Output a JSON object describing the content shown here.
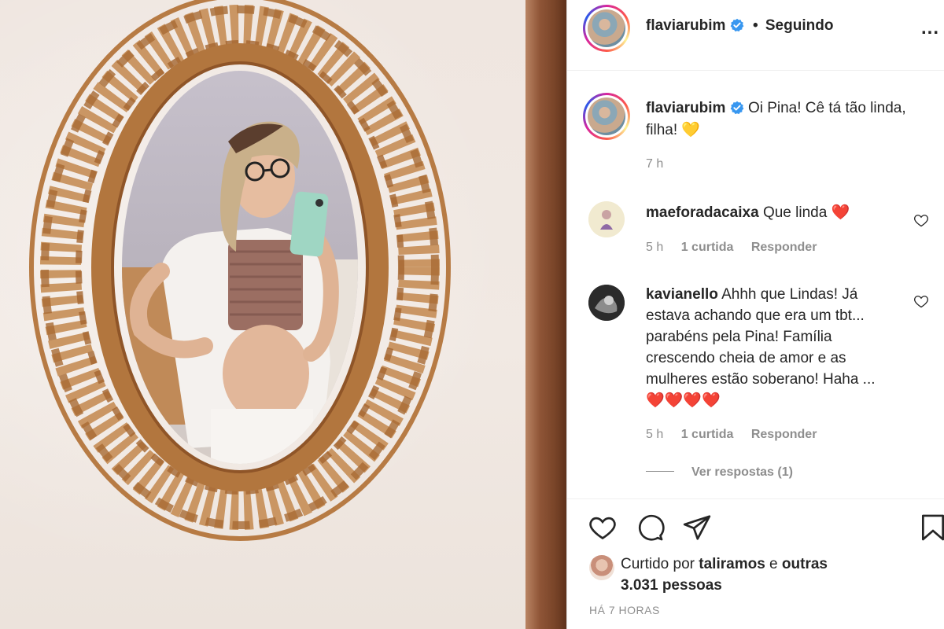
{
  "post_author": {
    "username": "flaviarubim",
    "follow_status": "Seguindo",
    "more_label": "..."
  },
  "caption": {
    "username": "flaviarubim",
    "text": "Oi Pina! Cê tá tão linda, filha!",
    "emoji": "💛",
    "time": "7 h"
  },
  "comments": [
    {
      "username": "maeforadacaixa",
      "text": "Que linda",
      "emoji": "❤️",
      "time": "5 h",
      "likes": "1 curtida",
      "reply_label": "Responder"
    },
    {
      "username": "kavianello",
      "text": "Ahhh que Lindas! Já estava achando que era um tbt... parabéns pela Pina! Família crescendo cheia de amor e as mulheres estão soberano! Haha ...",
      "emoji": "❤️❤️❤️❤️",
      "time": "5 h",
      "likes": "1 curtida",
      "reply_label": "Responder",
      "view_replies": "Ver respostas (1)"
    }
  ],
  "likes": {
    "prefix": "Curtido por",
    "user": "taliramos",
    "conjunction": "e",
    "others": "outras 3.031 pessoas"
  },
  "post_time": "HÁ 7 HORAS",
  "icons": [
    "heart-icon",
    "comment-icon",
    "share-icon",
    "bookmark-icon",
    "verified-icon",
    "more-icon"
  ],
  "colors": {
    "verified": "#3897f0",
    "heart_red": "#e0245e",
    "muted": "#8e8e8e",
    "text": "#262626"
  }
}
